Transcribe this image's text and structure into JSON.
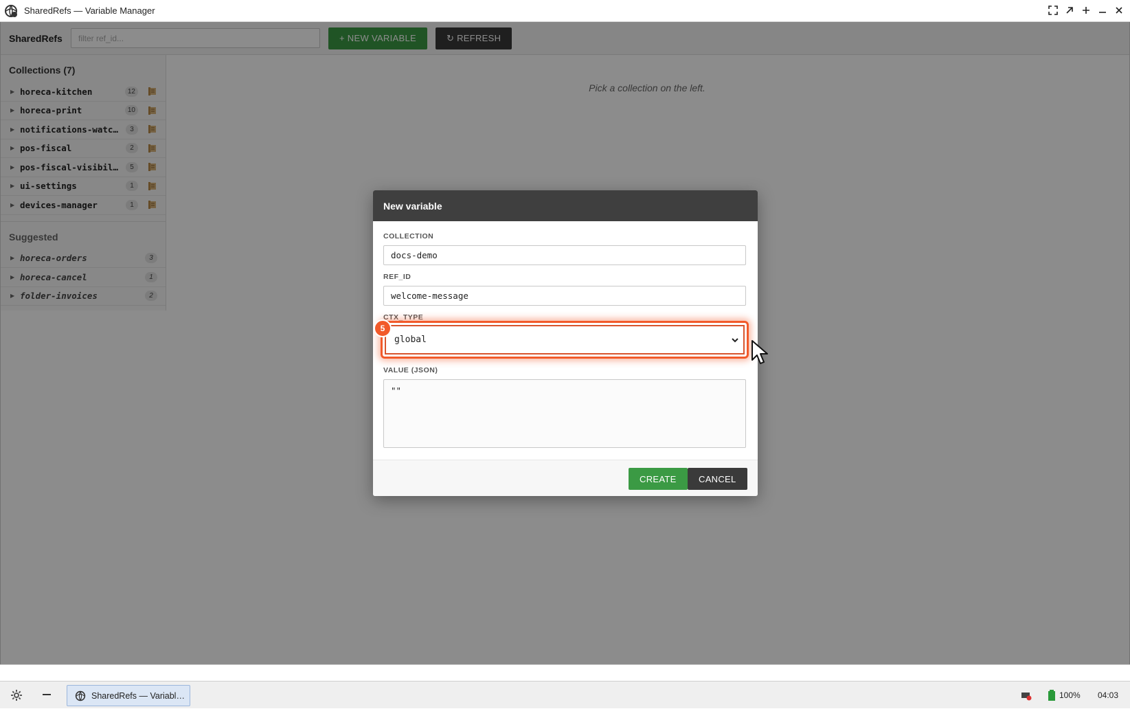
{
  "window": {
    "title": "SharedRefs — Variable Manager"
  },
  "toolbar": {
    "brand": "SharedRefs",
    "filter_placeholder": "filter ref_id...",
    "new_variable_label": "+ NEW VARIABLE",
    "refresh_label": "↻ REFRESH"
  },
  "sidebar": {
    "collections_title": "Collections (7)",
    "collections": [
      {
        "name": "horeca-kitchen",
        "count": "12"
      },
      {
        "name": "horeca-print",
        "count": "10"
      },
      {
        "name": "notifications-watch…",
        "count": "3"
      },
      {
        "name": "pos-fiscal",
        "count": "2"
      },
      {
        "name": "pos-fiscal-visibili…",
        "count": "5"
      },
      {
        "name": "ui-settings",
        "count": "1"
      },
      {
        "name": "devices-manager",
        "count": "1"
      }
    ],
    "suggested_title": "Suggested",
    "suggested": [
      {
        "name": "horeca-orders",
        "count": "3"
      },
      {
        "name": "horeca-cancel",
        "count": "1"
      },
      {
        "name": "folder-invoices",
        "count": "2"
      }
    ]
  },
  "main": {
    "hint": "Pick a collection on the left."
  },
  "modal": {
    "title": "New variable",
    "collection_label": "COLLECTION",
    "collection_value": "docs-demo",
    "ref_id_label": "REF_ID",
    "ref_id_value": "welcome-message",
    "ctx_type_label": "CTX_TYPE",
    "ctx_type_value": "global",
    "value_label": "VALUE (JSON)",
    "value_value": "\"\"",
    "create_label": "CREATE",
    "cancel_label": "CANCEL",
    "step_badge": "5"
  },
  "taskbar": {
    "task_label": "SharedRefs — Variabl…",
    "battery": "100%",
    "clock": "04:03"
  },
  "colors": {
    "primary_green": "#3b9a44",
    "dark_button": "#3a3a3a",
    "highlight_orange": "#f25a2a"
  }
}
